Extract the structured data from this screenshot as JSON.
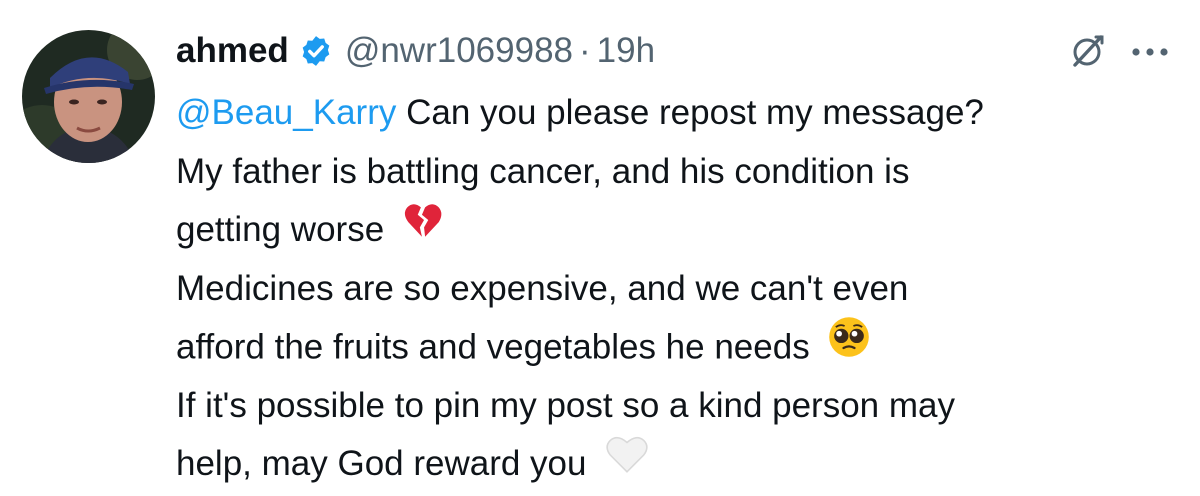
{
  "author": {
    "display_name": "ahmed",
    "handle": "@nwr1069988",
    "separator": "·",
    "timestamp": "19h",
    "verified": true
  },
  "post": {
    "mention": "@Beau_Karry",
    "lines": [
      " Can you please repost my message?",
      "My father is battling cancer, and his condition is",
      "getting worse",
      "Medicines are so expensive, and we can't even",
      "afford the fruits and vegetables he needs",
      "If it's possible to pin my post so a kind person may",
      "help, may God reward you"
    ],
    "emojis": {
      "line3": "broken-heart",
      "line5": "pleading-face",
      "line7": "white-heart"
    }
  },
  "icons": {
    "verified": "verified-badge-icon",
    "grok": "grok-icon",
    "more": "more-dots-icon"
  },
  "colors": {
    "text": "#0f1419",
    "secondary": "#536471",
    "accent": "#1d9bf0",
    "background": "#ffffff"
  }
}
